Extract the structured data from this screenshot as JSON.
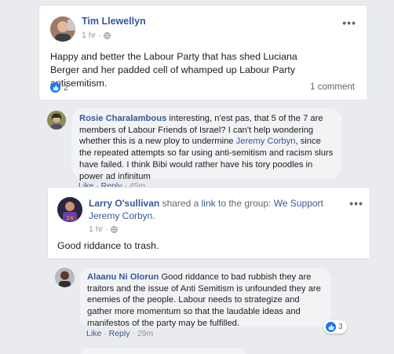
{
  "post1": {
    "author": "Tim Llewellyn",
    "time": "1 hr",
    "separator": "·",
    "text": "Happy and better the Labour Party that has shed Luciana Berger and her padded cell of whamped up Labour Party antisemitism.",
    "like_count": "2",
    "comment_count": "1 comment"
  },
  "comment1": {
    "author": "Rosie Charalambous",
    "text_before_link": "interesting, n'est pas, that 5 of the 7 are members of Labour Friends of Israel? I can't help wondering whether this is a new ploy to undermine ",
    "link": "Jeremy Corbyn",
    "text_after_link": ", since the repeated attempts so far using anti-semitism and racism slurs have failed. I think Bibi would rather have his tory poodles in power ad infinitum",
    "actions": [
      "Like",
      "Reply",
      "45m"
    ]
  },
  "post2": {
    "author": "Larry O'sullivan",
    "shared_text": "shared a",
    "link_word": "link",
    "to_group_text": "to the group:",
    "group": "We Support Jeremy Corbyn.",
    "time": "1 hr",
    "separator": "·",
    "text": "Good riddance to trash."
  },
  "comment2": {
    "author": "Alaanu Ni Olorun",
    "text": "Good riddance to bad rubbish they are traitors and the issue of Anti Semitism is unfounded they are enemies of the people. Labour needs to strategize and gather more momentum so that the laudable ideas and manifestos of the party may be fulfilled.",
    "actions": [
      "Like",
      "Reply",
      "29m"
    ],
    "reaction_count": "3"
  },
  "icons": {
    "more": "more-options-icon",
    "globe": "globe-icon",
    "like": "like-reaction-icon"
  },
  "colors": {
    "link": "#385898",
    "like_blue": "#1877f2",
    "background": "#e9ebee"
  }
}
